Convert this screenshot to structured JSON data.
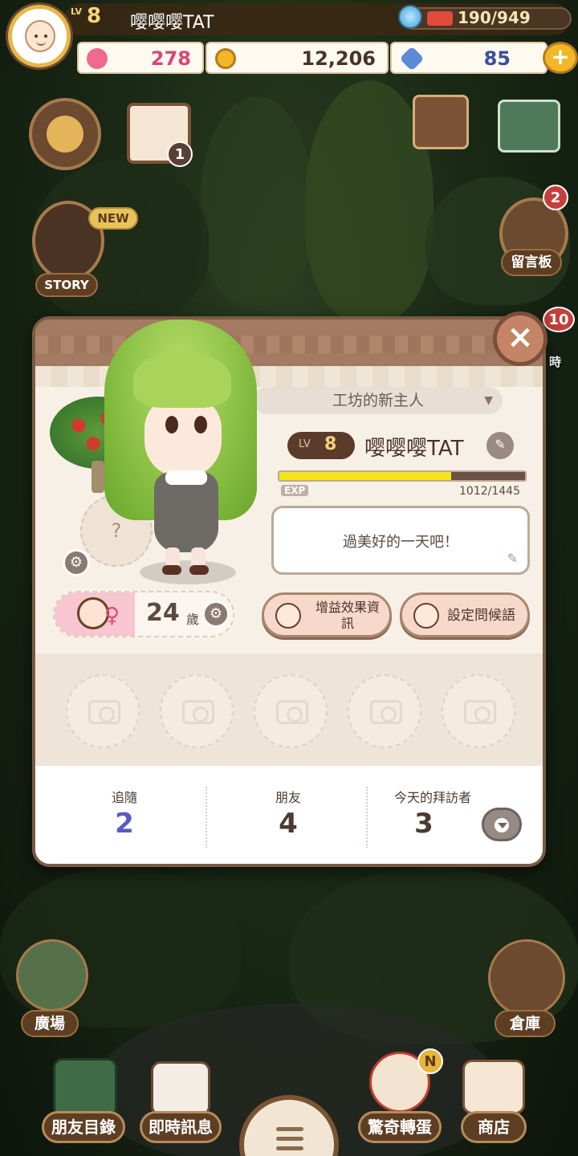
{
  "hud": {
    "level_prefix": "LV",
    "level": "8",
    "player_name": "嘤嘤嘤TAT",
    "energy": "190/949",
    "energy_fraction": 0.2,
    "hearts": "278",
    "coins": "12,206",
    "gems": "85",
    "plus": "+"
  },
  "side": {
    "story_new": "NEW",
    "story": "STORY",
    "calendar_badge": "1",
    "message_board": "留言板",
    "message_board_badge": "2",
    "right_badge": "10",
    "right_partial": "時",
    "plaza": "廣場",
    "warehouse": "倉庫"
  },
  "dialog": {
    "title": "工坊的新主人",
    "level_prefix": "LV",
    "level": "8",
    "name": "嘤嘤嘤TAT",
    "exp_label": "EXP",
    "exp_text": "1012/1445",
    "exp_fraction": 0.7,
    "greeting": "過美好的一天吧！",
    "age": "24",
    "age_unit": "歲",
    "star_slot": "?",
    "buff_button": "增益效果資\n訊",
    "greet_button": "設定問候語",
    "close": "×",
    "stats": [
      {
        "label": "追隨",
        "value": "2",
        "color": "#5a5bc4"
      },
      {
        "label": "朋友",
        "value": "4",
        "color": "#4a3a32"
      },
      {
        "label": "今天的拜訪者",
        "value": "3",
        "color": "#4a3a32"
      }
    ]
  },
  "bottom": {
    "friends": "朋友目錄",
    "messages": "即時訊息",
    "gacha": "驚奇轉蛋",
    "gacha_badge": "N",
    "shop": "商店"
  }
}
